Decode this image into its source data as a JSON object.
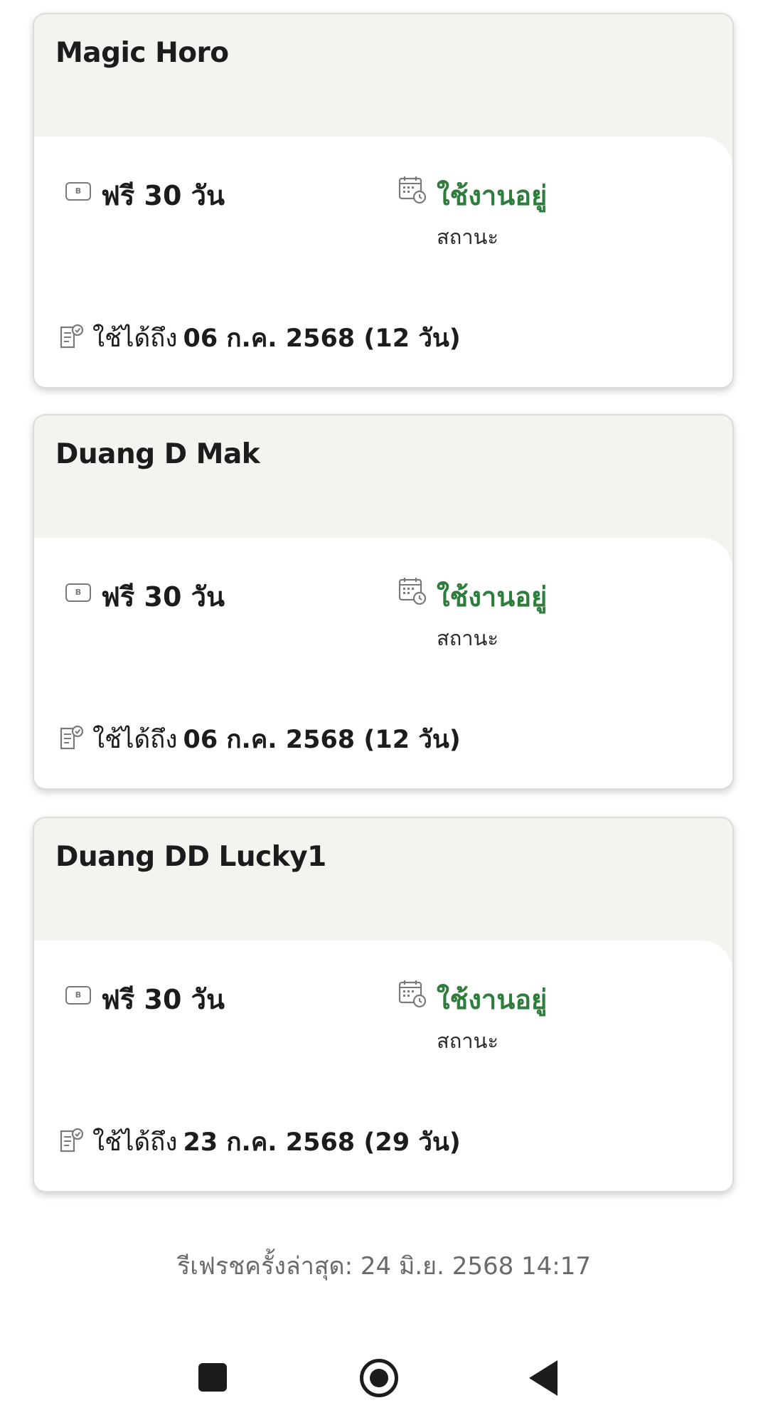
{
  "cards": [
    {
      "title": "Magic Horo",
      "plan": "ฟรี 30 วัน",
      "status": "ใช้งานอยู่",
      "status_caption": "สถานะ",
      "valid_label": "ใช้ได้ถึง",
      "valid_date": "06 ก.ค. 2568 (12 วัน)"
    },
    {
      "title": "Duang D Mak",
      "plan": "ฟรี 30 วัน",
      "status": "ใช้งานอยู่",
      "status_caption": "สถานะ",
      "valid_label": "ใช้ได้ถึง",
      "valid_date": "06 ก.ค. 2568 (12 วัน)"
    },
    {
      "title": "Duang DD Lucky1",
      "plan": "ฟรี 30 วัน",
      "status": "ใช้งานอยู่",
      "status_caption": "สถานะ",
      "valid_label": "ใช้ได้ถึง",
      "valid_date": "23 ก.ค. 2568 (29 วัน)"
    }
  ],
  "footer": {
    "last_refresh": "รีเฟรชครั้งล่าสุด: 24 มิ.ย. 2568 14:17"
  },
  "icons": {
    "plan": "baht-card-icon",
    "status": "calendar-clock-icon",
    "validity": "document-check-icon"
  },
  "colors": {
    "status_active": "#2f7d3c",
    "card_header_bg": "#f3f3ef"
  }
}
